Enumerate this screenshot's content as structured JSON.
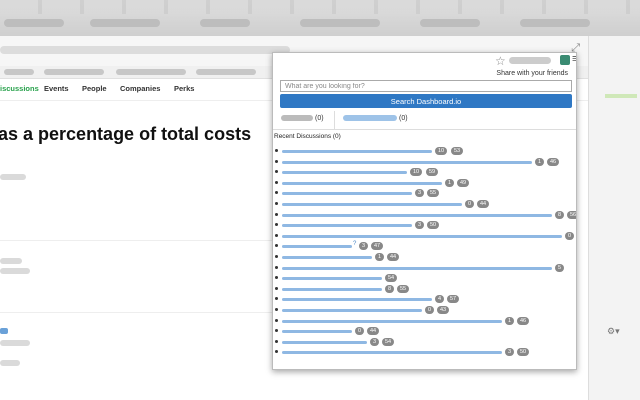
{
  "site_nav": {
    "items": [
      {
        "label": "iscussions",
        "active": true
      },
      {
        "label": "Events",
        "active": false
      },
      {
        "label": "People",
        "active": false
      },
      {
        "label": "Companies",
        "active": false
      },
      {
        "label": "Perks",
        "active": false
      }
    ]
  },
  "page": {
    "headline": "as a percentage of total costs"
  },
  "popup": {
    "share_label": "Share with your friends",
    "search_placeholder": "What are you looking for?",
    "search_button": "Search Dashboard.io",
    "tabs": [
      {
        "count": "(0)"
      },
      {
        "count": "(0)"
      }
    ],
    "recent_title": "Recent Discussions (0)",
    "discussions": [
      {
        "badges": [
          "10",
          "53"
        ],
        "question": false
      },
      {
        "badges": [
          "1",
          "46"
        ],
        "question": false
      },
      {
        "badges": [
          "10",
          "59"
        ],
        "question": false
      },
      {
        "badges": [
          "1",
          "49"
        ],
        "question": false
      },
      {
        "badges": [
          "3",
          "55"
        ],
        "question": false
      },
      {
        "badges": [
          "0",
          "44"
        ],
        "question": false
      },
      {
        "badges": [
          "8",
          "56"
        ],
        "question": false
      },
      {
        "badges": [
          "3",
          "50"
        ],
        "question": false
      },
      {
        "badges": [
          "0",
          "32"
        ],
        "question": false
      },
      {
        "badges": [
          "3",
          "47"
        ],
        "question": true
      },
      {
        "badges": [
          "1",
          "44"
        ],
        "question": false
      },
      {
        "badges": [
          "5"
        ],
        "question": false
      },
      {
        "badges": [
          "54"
        ],
        "question": false
      },
      {
        "badges": [
          "8",
          "55"
        ],
        "question": false
      },
      {
        "badges": [
          "4",
          "57"
        ],
        "question": false
      },
      {
        "badges": [
          "0",
          "43"
        ],
        "question": false
      },
      {
        "badges": [
          "1",
          "46"
        ],
        "question": false
      },
      {
        "badges": [
          "0",
          "44"
        ],
        "question": false
      },
      {
        "badges": [
          "3",
          "54"
        ],
        "question": false
      },
      {
        "badges": [
          "3",
          "50"
        ],
        "question": false
      }
    ]
  },
  "icons": [
    "star-icon",
    "extension-icon",
    "menu-icon",
    "expand-icon",
    "gear-icon"
  ],
  "colors": {
    "accent_green": "#27a14b",
    "button_blue": "#2f78c4",
    "badge_gray": "#888888",
    "link_blue": "#8fb8e3"
  }
}
